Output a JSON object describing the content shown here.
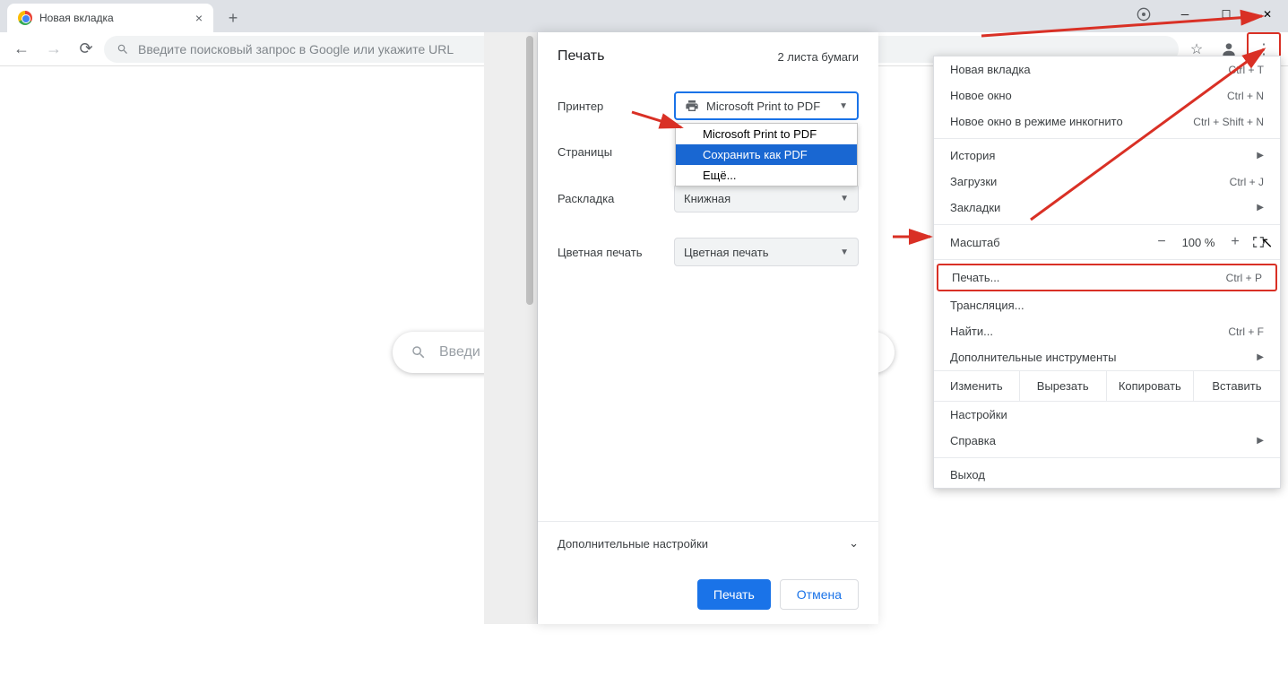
{
  "titlebar": {
    "tab_title": "Новая вкладка"
  },
  "toolbar": {
    "omnibox_placeholder": "Введите поисковый запрос в Google или укажите URL"
  },
  "page": {
    "search_placeholder": "Введи"
  },
  "print": {
    "title": "Печать",
    "sheets": "2 листа бумаги",
    "printer_label": "Принтер",
    "printer_value": "Microsoft Print to PDF",
    "printer_options": [
      "Microsoft Print to PDF",
      "Сохранить как PDF",
      "Ещё..."
    ],
    "pages_label": "Страницы",
    "layout_label": "Раскладка",
    "layout_value": "Книжная",
    "color_label": "Цветная печать",
    "color_value": "Цветная печать",
    "more": "Дополнительные настройки",
    "print_btn": "Печать",
    "cancel_btn": "Отмена"
  },
  "menu": {
    "new_tab": "Новая вкладка",
    "new_tab_sc": "Ctrl + T",
    "new_window": "Новое окно",
    "new_window_sc": "Ctrl + N",
    "incognito": "Новое окно в режиме инкогнито",
    "incognito_sc": "Ctrl + Shift + N",
    "history": "История",
    "downloads": "Загрузки",
    "downloads_sc": "Ctrl + J",
    "bookmarks": "Закладки",
    "zoom_label": "Масштаб",
    "zoom_value": "100 %",
    "print": "Печать...",
    "print_sc": "Ctrl + P",
    "cast": "Трансляция...",
    "find": "Найти...",
    "find_sc": "Ctrl + F",
    "more_tools": "Дополнительные инструменты",
    "edit_label": "Изменить",
    "cut": "Вырезать",
    "copy": "Копировать",
    "paste": "Вставить",
    "settings": "Настройки",
    "help": "Справка",
    "exit": "Выход"
  }
}
